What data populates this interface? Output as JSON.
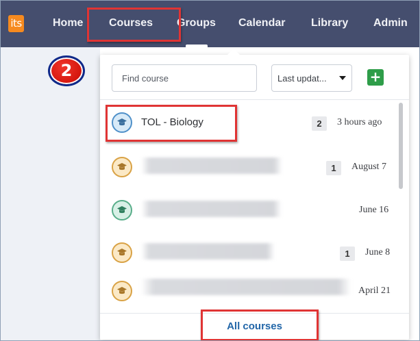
{
  "nav": {
    "logo_text": "its",
    "items": [
      {
        "label": "Home"
      },
      {
        "label": "Courses"
      },
      {
        "label": "Groups"
      },
      {
        "label": "Calendar"
      },
      {
        "label": "Library"
      },
      {
        "label": "Admin"
      }
    ],
    "active": "Courses"
  },
  "step_badge": "2",
  "courses_menu": {
    "search": {
      "placeholder": "Find course",
      "value": ""
    },
    "sort": {
      "selected": "Last updat..."
    },
    "add_button": "+",
    "rows": [
      {
        "name": "TOL - Biology",
        "blurred": false,
        "icon": "graduation-cap-icon",
        "icon_color": "blue",
        "count": "2",
        "updated": "3 hours ago"
      },
      {
        "name": "",
        "blurred": true,
        "icon": "graduation-cap-icon",
        "icon_color": "gold",
        "count": "1",
        "updated": "August 7"
      },
      {
        "name": "",
        "blurred": true,
        "icon": "graduation-cap-icon",
        "icon_color": "green",
        "count": "",
        "updated": "June 16"
      },
      {
        "name": "",
        "blurred": true,
        "icon": "graduation-cap-icon",
        "icon_color": "gold",
        "count": "1",
        "updated": "June 8"
      },
      {
        "name": "",
        "blurred": true,
        "icon": "graduation-cap-icon",
        "icon_color": "gold",
        "count": "",
        "updated": "April 21"
      }
    ],
    "all_courses_label": "All courses"
  },
  "colors": {
    "navbar": "#454e6e",
    "logo": "#f68a1f",
    "add_button": "#2e9d49",
    "link": "#2266a8",
    "highlight": "#e03434"
  }
}
